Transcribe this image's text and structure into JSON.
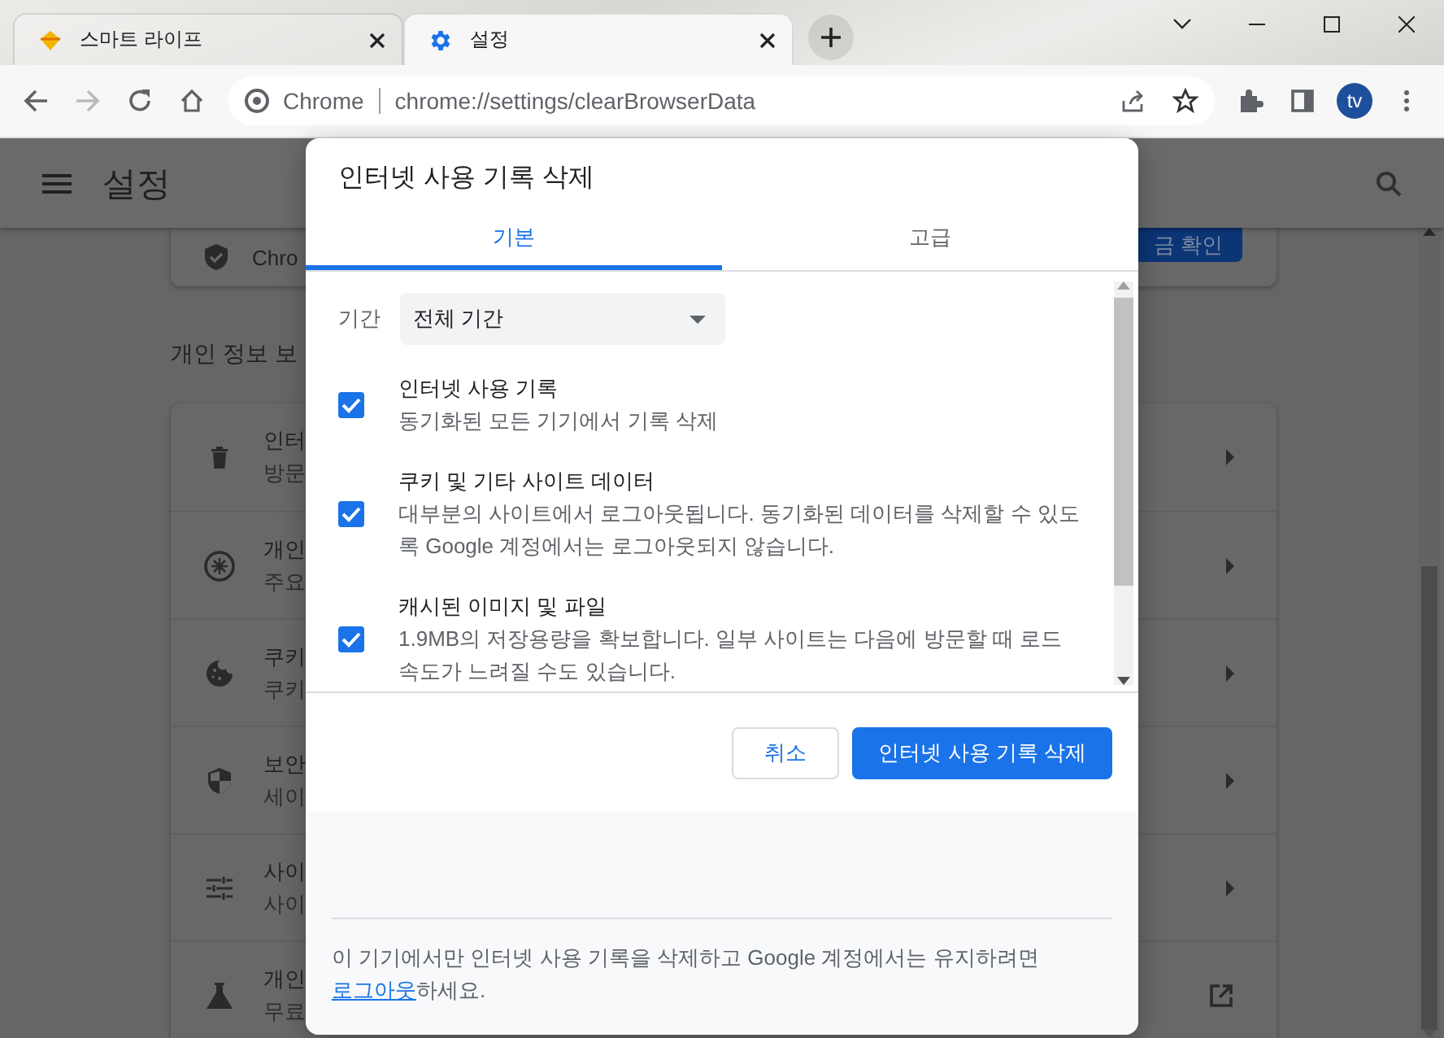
{
  "tabs": [
    {
      "title": "스마트 라이프",
      "selected": false
    },
    {
      "title": "설정",
      "selected": true
    }
  ],
  "toolbar": {
    "site_label": "Chrome",
    "url": "chrome://settings/clearBrowserData",
    "profile_initials": "tv"
  },
  "settings_page": {
    "title": "설정",
    "safety_card": {
      "text": "Chro",
      "button": "금 확인"
    },
    "section_title": "개인 정보 보",
    "rows": [
      {
        "title": "인터",
        "subtitle": "방문",
        "kind": "submenu"
      },
      {
        "title": "개인",
        "subtitle": "주요",
        "kind": "submenu"
      },
      {
        "title": "쿠키",
        "subtitle": "쿠키",
        "kind": "submenu"
      },
      {
        "title": "보안",
        "subtitle": "세이",
        "kind": "submenu"
      },
      {
        "title": "사이",
        "subtitle": "사이",
        "kind": "submenu"
      },
      {
        "title": "개인",
        "subtitle": "무료",
        "kind": "external"
      }
    ]
  },
  "dialog": {
    "title": "인터넷 사용 기록 삭제",
    "tabs": [
      {
        "label": "기본",
        "selected": true
      },
      {
        "label": "고급",
        "selected": false
      }
    ],
    "time_range": {
      "label": "기간",
      "value": "전체 기간"
    },
    "options": [
      {
        "title": "인터넷 사용 기록",
        "description": "동기화된 모든 기기에서 기록 삭제",
        "checked": true
      },
      {
        "title": "쿠키 및 기타 사이트 데이터",
        "description": "대부분의 사이트에서 로그아웃됩니다. 동기화된 데이터를 삭제할 수 있도록 Google 계정에서는 로그아웃되지 않습니다.",
        "checked": true
      },
      {
        "title": "캐시된 이미지 및 파일",
        "description": "1.9MB의 저장용량을 확보합니다. 일부 사이트는 다음에 방문할 때 로드 속도가 느려질 수도 있습니다.",
        "checked": true
      }
    ],
    "buttons": {
      "cancel": "취소",
      "confirm": "인터넷 사용 기록 삭제"
    },
    "footer": {
      "text": "이 기기에서만 인터넷 사용 기록을 삭제하고 Google 계정에서는 유지하려면 ",
      "link": "로그아웃",
      "suffix": "하세요."
    }
  }
}
